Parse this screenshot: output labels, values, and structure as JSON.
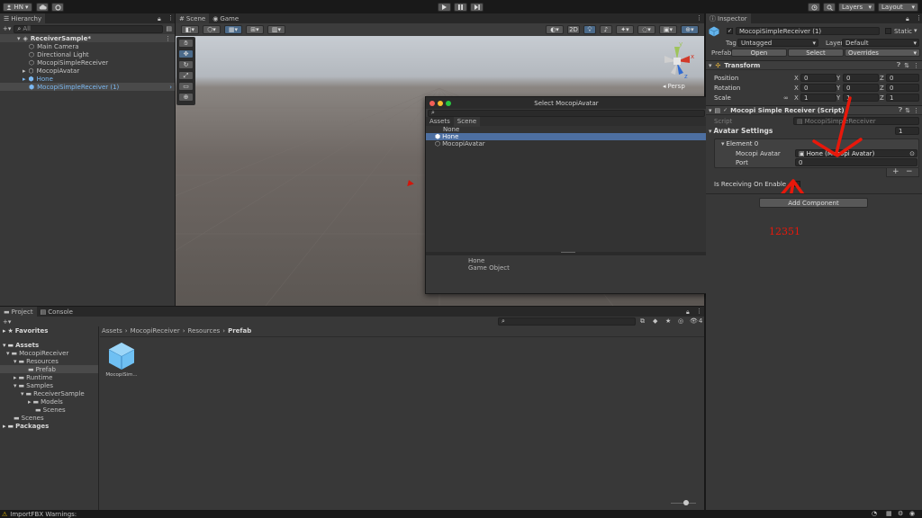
{
  "colors": {
    "accent": "#2c5d87",
    "selected_row": "#4d6fa1",
    "annotation": "#e8180b",
    "warning": "#e6b800"
  },
  "toolbar": {
    "account": "HN",
    "play_icon": "play-icon",
    "layers": "Layers",
    "layout": "Layout"
  },
  "hierarchy": {
    "tab": "Hierarchy",
    "search_placeholder": "All",
    "scene": "ReceiverSample*",
    "items": [
      "Main Camera",
      "Directional Light",
      "MocopiSimpleReceiver",
      "MocopiAvatar",
      "Hone",
      "MocopiSimpleReceiver (1)"
    ]
  },
  "scene_view": {
    "tabs": [
      "Scene",
      "Game"
    ],
    "mode_2d": "2D",
    "persp": "Persp",
    "gizmo_y": "y",
    "gizmo_x": "x",
    "gizmo_z": "z"
  },
  "select_window": {
    "title": "Select MocopiAvatar",
    "tabs": [
      "Assets",
      "Scene"
    ],
    "items": [
      "None",
      "Hone",
      "MocopiAvatar"
    ],
    "selected_index": 1,
    "preview_name": "Hone",
    "preview_type": "Game Object"
  },
  "inspector": {
    "tab": "Inspector",
    "object_name": "MocopiSimpleReceiver (1)",
    "static": "Static",
    "tag_label": "Tag",
    "tag_value": "Untagged",
    "layer_label": "Layer",
    "layer_value": "Default",
    "prefab_label": "Prefab",
    "prefab_open": "Open",
    "prefab_select": "Select",
    "prefab_overrides": "Overrides",
    "transform": {
      "title": "Transform",
      "rows": [
        {
          "label": "Position",
          "x": "0",
          "y": "0",
          "z": "0"
        },
        {
          "label": "Rotation",
          "x": "0",
          "y": "0",
          "z": "0"
        },
        {
          "label": "Scale",
          "x": "1",
          "y": "1",
          "z": "1"
        }
      ],
      "x": "X",
      "y": "Y",
      "z": "Z"
    },
    "script": {
      "title": "Mocopi Simple Receiver (Script)",
      "script_label": "Script",
      "script_value": "MocopiSimpleReceiver",
      "avatar_settings": "Avatar Settings",
      "avatar_count": "1",
      "element": "Element 0",
      "mocopi_avatar_label": "Mocopi Avatar",
      "mocopi_avatar_value": "Hone (Mocopi Avatar)",
      "port_label": "Port",
      "port_value": "0",
      "plus": "+",
      "minus": "−",
      "receiving_label": "Is Receiving On Enable"
    },
    "add_component": "Add Component"
  },
  "annotation": {
    "number": "12351"
  },
  "project": {
    "tabs": [
      "Project",
      "Console"
    ],
    "favorites": "Favorites",
    "assets": "Assets",
    "tree": [
      {
        "label": "MocopiReceiver",
        "depth": 1
      },
      {
        "label": "Resources",
        "depth": 2
      },
      {
        "label": "Prefab",
        "depth": 3
      },
      {
        "label": "Runtime",
        "depth": 2
      },
      {
        "label": "Samples",
        "depth": 2
      },
      {
        "label": "ReceiverSample",
        "depth": 3
      },
      {
        "label": "Models",
        "depth": 4
      },
      {
        "label": "Scenes",
        "depth": 4
      },
      {
        "label": "Scenes",
        "depth": 1
      }
    ],
    "packages": "Packages",
    "breadcrumb": [
      "Assets",
      "MocopiReceiver",
      "Resources",
      "Prefab"
    ],
    "asset_label": "MocopiSim...",
    "count": "4"
  },
  "status": {
    "warning": "ImportFBX Warnings:"
  }
}
